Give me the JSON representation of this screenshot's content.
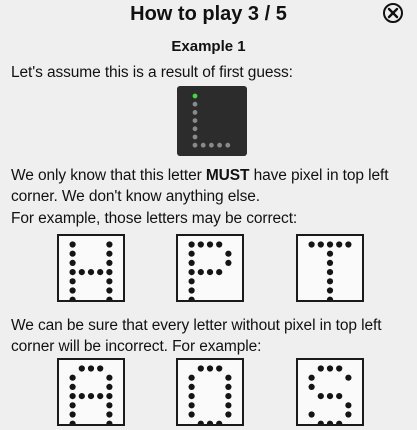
{
  "header": {
    "title": "How to play 3 / 5",
    "close_icon": "close-circle-icon"
  },
  "example": {
    "heading": "Example 1",
    "intro": "Let's assume this is a result of first guess:",
    "guess_tile": {
      "pattern": [
        "G....",
        "#....",
        "#....",
        "#....",
        "#....",
        "#....",
        "#####"
      ],
      "colors": {
        "bg": "#2c2c2c",
        "hit": "#3ddc3d",
        "miss": "#8a8a8a"
      }
    },
    "para1_before": "We only know that this letter ",
    "para1_strong": "MUST",
    "para1_after": " have pixel in top left corner. We don't know anything else.",
    "para2": "For example, those letters may be correct:",
    "correct_letters": [
      {
        "letter": "H",
        "pattern": [
          "#...#",
          "#...#",
          "#...#",
          "#####",
          "#...#",
          "#...#",
          "#...#"
        ]
      },
      {
        "letter": "P",
        "pattern": [
          "####.",
          "#...#",
          "#...#",
          "####.",
          "#....",
          "#....",
          "#...."
        ]
      },
      {
        "letter": "T",
        "pattern": [
          "#####",
          "..#..",
          "..#..",
          "..#..",
          "..#..",
          "..#..",
          "..#.."
        ]
      }
    ],
    "para3": "We can be sure that every letter without pixel in top left corner will be incorrect. For example:",
    "incorrect_letters": [
      {
        "letter": "A",
        "pattern": [
          ".###.",
          "#...#",
          "#...#",
          "#####",
          "#...#",
          "#...#",
          "#...#"
        ]
      },
      {
        "letter": "O",
        "pattern": [
          ".###.",
          "#...#",
          "#...#",
          "#...#",
          "#...#",
          "#...#",
          ".###."
        ]
      },
      {
        "letter": "S",
        "pattern": [
          ".###.",
          "#...#",
          "#....",
          ".###.",
          "....#",
          "#...#",
          ".###."
        ]
      }
    ]
  }
}
